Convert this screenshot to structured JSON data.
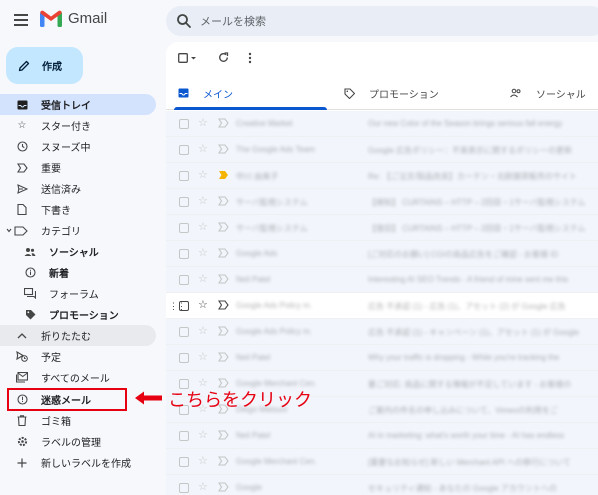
{
  "app": {
    "name": "Gmail",
    "brand_color": "#ea4335"
  },
  "search": {
    "placeholder": "メールを検索"
  },
  "compose": {
    "label": "作成"
  },
  "sidebar": {
    "items": [
      {
        "label": "受信トレイ",
        "icon": "inbox-icon",
        "bold": true,
        "active": true
      },
      {
        "label": "スター付き",
        "icon": "star-icon"
      },
      {
        "label": "スヌーズ中",
        "icon": "clock-icon"
      },
      {
        "label": "重要",
        "icon": "important-icon"
      },
      {
        "label": "送信済み",
        "icon": "send-icon"
      },
      {
        "label": "下書き",
        "icon": "draft-icon"
      },
      {
        "label": "カテゴリ",
        "icon": "label-icon"
      },
      {
        "label": "ソーシャル",
        "icon": "people-icon",
        "bold": true
      },
      {
        "label": "新着",
        "icon": "info-icon",
        "bold": true
      },
      {
        "label": "フォーラム",
        "icon": "forum-icon"
      },
      {
        "label": "プロモーション",
        "icon": "tag-icon",
        "bold": true
      },
      {
        "label": "折りたたむ",
        "icon": "chevron-up-icon"
      },
      {
        "label": "予定",
        "icon": "scheduled-icon"
      },
      {
        "label": "すべてのメール",
        "icon": "all-mail-icon"
      },
      {
        "label": "迷惑メール",
        "icon": "spam-icon",
        "bold": true
      },
      {
        "label": "ゴミ箱",
        "icon": "trash-icon"
      },
      {
        "label": "ラベルの管理",
        "icon": "gear-icon"
      },
      {
        "label": "新しいラベルを作成",
        "icon": "plus-icon"
      }
    ]
  },
  "annotation": {
    "text": "こちらをクリック",
    "color": "#e60012"
  },
  "tabs": [
    {
      "label": "メイン",
      "icon": "inbox-tab-icon",
      "active": true
    },
    {
      "label": "プロモーション",
      "icon": "tag-tab-icon"
    },
    {
      "label": "ソーシャル",
      "icon": "people-tab-icon"
    }
  ],
  "emails": [
    {
      "sender": "Creative Market",
      "subject": "Our new Color of the Season brings serious fall energy"
    },
    {
      "sender": "The Google Ads Team",
      "subject": "Google 広告ポリシー：不実表示に関するポリシーの更新"
    },
    {
      "sender": "中川 由美子",
      "subject": "Re: 【ご注文/製品改良】カーテン・北欧雑貨販売のサイト",
      "important": true
    },
    {
      "sender": "サーバ監視システム",
      "subject": "【検知】 CURTAINS – HTTP – 2回目・1サーバ監視システム"
    },
    {
      "sender": "サーバ監視システム",
      "subject": "【復旧】 CURTAINS – HTTP – 2回目・1サーバ監視システム"
    },
    {
      "sender": "Google Ads",
      "subject": "[ご対応のお願い] CGIの商品広告をご確認 - お客様 ID"
    },
    {
      "sender": "Neil Patel",
      "subject": "Interesting AI SEO Trends - A friend of mine sent me this"
    },
    {
      "sender": "Google Ads Policy m.",
      "subject": "広告 不承認 (1) - 広告 (1)、アセット (2) が Google 広告",
      "hover": true
    },
    {
      "sender": "Google Ads Policy m.",
      "subject": "広告 不承認 (1) - キャンペーン (1)、アセット (1) が Google"
    },
    {
      "sender": "Neil Patel",
      "subject": "Why your traffic is dropping - While you're tracking the"
    },
    {
      "sender": "Google Merchant Cen.",
      "subject": "要ご対応: 商品に関する情報が不足しています - お客様の"
    },
    {
      "sender": "Diego Matsuoi",
      "subject": "ご案内の件名の申し込みについて、Vimeoの利用をご"
    },
    {
      "sender": "Neil Patel",
      "subject": "AI in marketing: what's worth your time - AI has endless"
    },
    {
      "sender": "Google Merchant Cen.",
      "subject": "[重要なお知らせ] 新しい Merchant API への移行について"
    },
    {
      "sender": "Google",
      "subject": "セキュリティ通知 - あなたの Google アカウントへの"
    }
  ]
}
